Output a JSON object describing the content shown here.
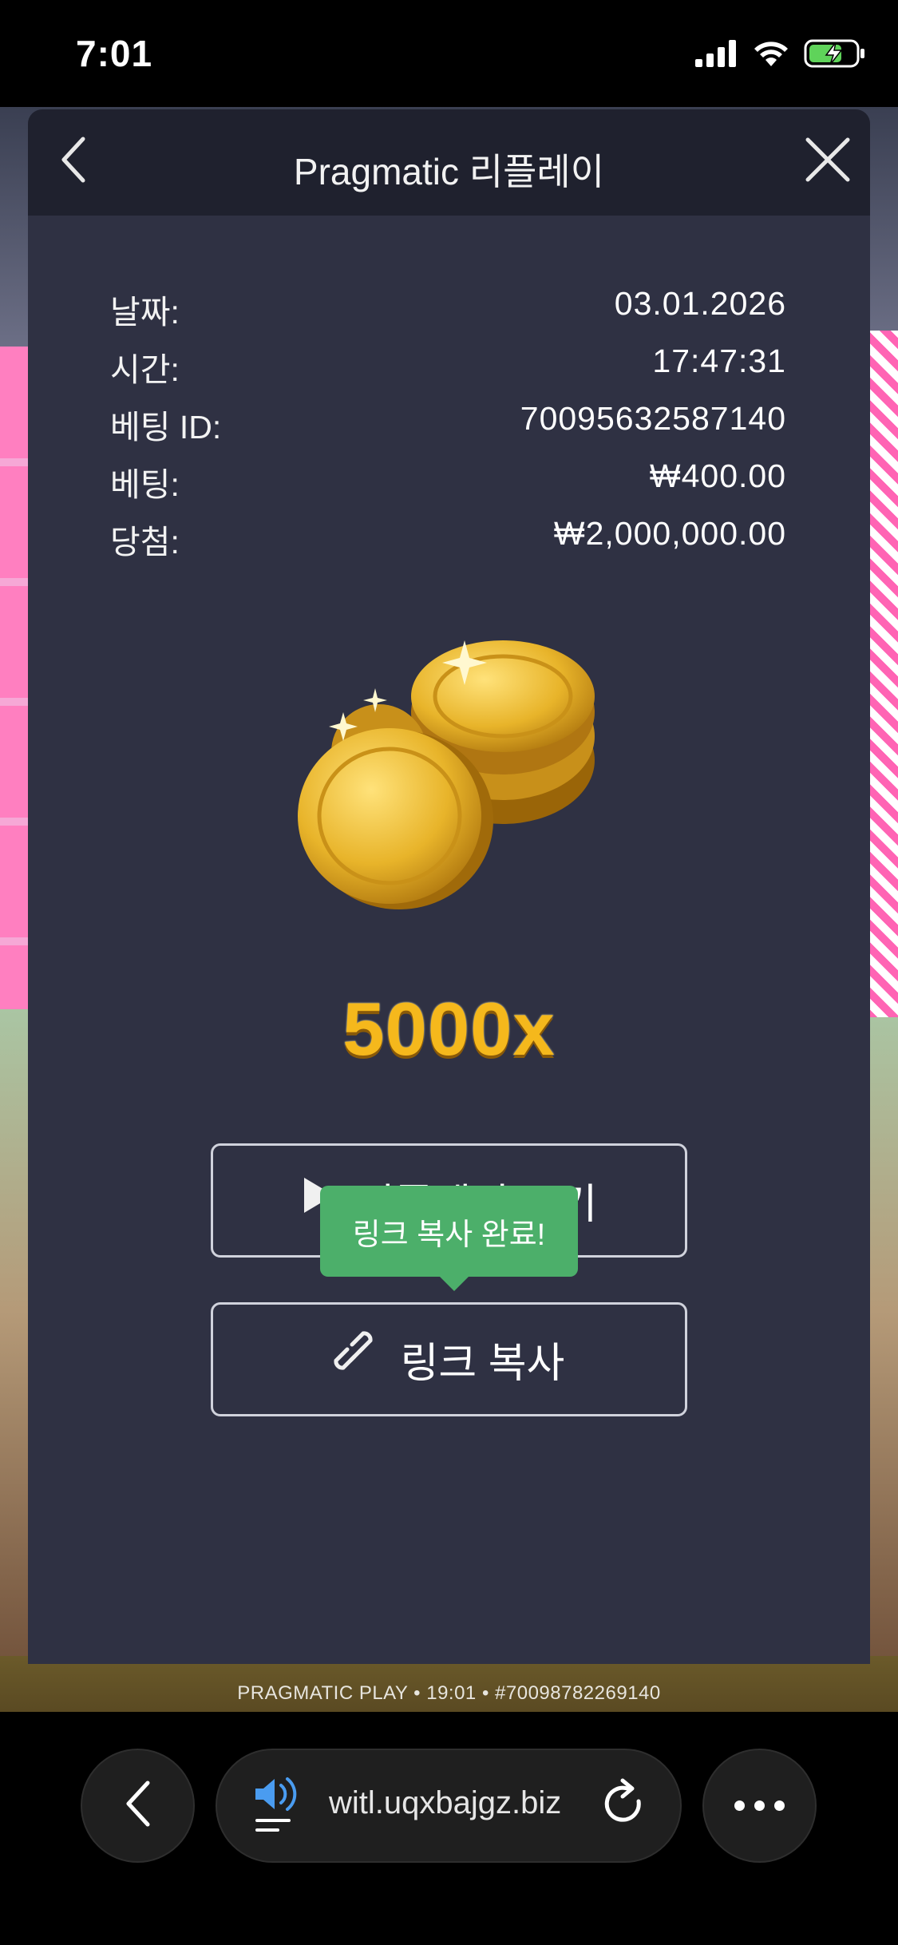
{
  "status_bar": {
    "time": "7:01",
    "icons": [
      "signal-icon",
      "wifi-icon",
      "battery-charging-icon"
    ]
  },
  "modal": {
    "title": "Pragmatic 리플레이",
    "back_icon": "chevron-left-icon",
    "close_icon": "close-icon",
    "info": [
      {
        "label": "날짜:",
        "value": "03.01.2026"
      },
      {
        "label": "시간:",
        "value": "17:47:31"
      },
      {
        "label": "베팅 ID:",
        "value": "70095632587140"
      },
      {
        "label": "베팅:",
        "value": "₩400.00"
      },
      {
        "label": "당첨:",
        "value": "₩2,000,000.00"
      }
    ],
    "multiplier": "5000x",
    "replay_button": {
      "label": "리플레이 보기",
      "icon": "play-icon"
    },
    "copy_button": {
      "label": "링크 복사",
      "icon": "link-icon"
    },
    "toast": "링크 복사 완료!"
  },
  "background": {
    "footer_text": "PRAGMATIC PLAY • 19:01 • #70098782269140"
  },
  "browser": {
    "url": "witl.uqxbajgz.biz",
    "back_icon": "chevron-left-icon",
    "sound_icon": "speaker-icon",
    "reload_icon": "reload-icon",
    "more_icon": "more-dots-icon"
  },
  "colors": {
    "modal_bg": "#2f3143",
    "header_bg": "#1f212e",
    "toast_bg": "#4caf6a",
    "multiplier": "#f5b81c"
  }
}
